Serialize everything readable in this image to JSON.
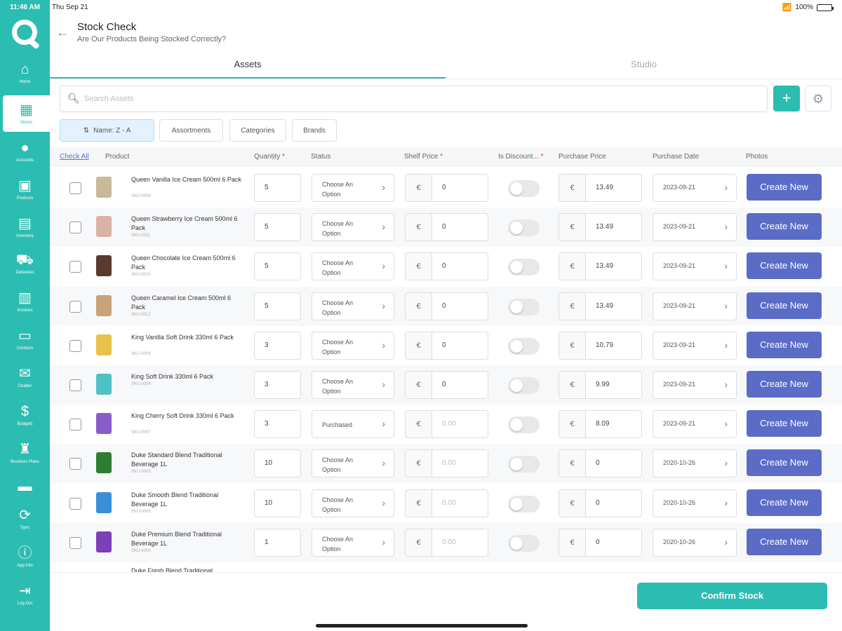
{
  "status_bar": {
    "time": "11:46 AM",
    "date": "Thu Sep 21",
    "battery": "100%"
  },
  "sidebar": {
    "items": [
      {
        "label": "Home",
        "icon": "home-icon"
      },
      {
        "label": "Stores",
        "icon": "store-icon",
        "active": true
      },
      {
        "label": "Accounts",
        "icon": "accounts-icon"
      },
      {
        "label": "Products",
        "icon": "products-icon"
      },
      {
        "label": "Inventory",
        "icon": "inventory-icon"
      },
      {
        "label": "Deliveries",
        "icon": "truck-icon"
      },
      {
        "label": "Invoices",
        "icon": "invoice-icon"
      },
      {
        "label": "Contacts",
        "icon": "contacts-icon"
      },
      {
        "label": "Chatter",
        "icon": "mail-icon"
      },
      {
        "label": "Budgets",
        "icon": "budget-icon"
      },
      {
        "label": "Business Plans",
        "icon": "business-plans-icon"
      },
      {
        "label": "",
        "icon": "card-icon"
      },
      {
        "label": "Sync",
        "icon": "sync-icon"
      },
      {
        "label": "App Info",
        "icon": "info-icon"
      },
      {
        "label": "Log Out",
        "icon": "logout-icon"
      }
    ]
  },
  "header": {
    "title": "Stock Check",
    "subtitle": "Are Our Products Being Stocked Correctly?"
  },
  "tabs": [
    {
      "label": "Assets",
      "active": true
    },
    {
      "label": "Studio"
    }
  ],
  "search": {
    "placeholder": "Search Assets",
    "value": ""
  },
  "filters": {
    "sort": "Name: Z - A",
    "assortments": "Assortments",
    "categories": "Categories",
    "brands": "Brands"
  },
  "columns": {
    "check_all": "Check All",
    "product": "Product",
    "quantity": "Quantity",
    "status": "Status",
    "shelf_price": "Shelf Price",
    "is_discounted": "Is Discount...",
    "purchase_price": "Purchase Price",
    "purchase_date": "Purchase Date",
    "photos": "Photos"
  },
  "currency": "€",
  "create_label": "Create New",
  "rows": [
    {
      "name": "Queen Vanilla Ice Cream 500ml 6 Pack",
      "sku": "SKU-0009",
      "qty": "5",
      "status": "Choose An Option",
      "shelf": "0",
      "purchase": "13.49",
      "date": "2023-09-21",
      "thumb": "#c8b99a"
    },
    {
      "name": "Queen Strawberry Ice Cream 500ml 6 Pack",
      "sku": "SKU-0011",
      "qty": "5",
      "status": "Choose An Option",
      "shelf": "0",
      "purchase": "13.49",
      "date": "2023-09-21",
      "thumb": "#d9b3a6"
    },
    {
      "name": "Queen Chocolate Ice Cream 500ml 6 Pack",
      "sku": "SKU-0010",
      "qty": "5",
      "status": "Choose An Option",
      "shelf": "0",
      "purchase": "13.49",
      "date": "2023-09-21",
      "thumb": "#5a3a2e"
    },
    {
      "name": "Queen Caramel Ice Cream 500ml 6 Pack",
      "sku": "SKU-0012",
      "qty": "5",
      "status": "Choose An Option",
      "shelf": "0",
      "purchase": "13.49",
      "date": "2023-09-21",
      "thumb": "#c9a27a"
    },
    {
      "name": "King Vanilla Soft Drink 330ml 6 Pack",
      "sku": "SKU-0008",
      "qty": "3",
      "status": "Choose An Option",
      "shelf": "0",
      "purchase": "10.79",
      "date": "2023-09-21",
      "thumb": "#e8c24a"
    },
    {
      "name": "King Soft Drink 330ml 6 Pack",
      "sku": "SKU-0006",
      "qty": "3",
      "status": "Choose An Option",
      "shelf": "0",
      "purchase": "9.99",
      "date": "2023-09-21",
      "thumb": "#4fc1c4"
    },
    {
      "name": "King Cherry Soft Drink 330ml 6 Pack",
      "sku": "SKU-0007",
      "qty": "3",
      "status": "Purchased",
      "shelf": "0.00",
      "shelf_placeholder": true,
      "purchase": "8.09",
      "date": "2023-09-21",
      "thumb": "#8a5cc9"
    },
    {
      "name": "Duke Standard Blend Traditional Beverage 1L",
      "sku": "SKU-0003",
      "qty": "10",
      "status": "Choose An Option",
      "shelf": "0.00",
      "shelf_placeholder": true,
      "purchase": "0",
      "date": "2020-10-26",
      "thumb": "#2e7d32"
    },
    {
      "name": "Duke Smooth Blend Traditional Beverage 1L",
      "sku": "SKU-0005",
      "qty": "10",
      "status": "Choose An Option",
      "shelf": "0.00",
      "shelf_placeholder": true,
      "purchase": "0",
      "date": "2020-10-26",
      "thumb": "#3a8fd9"
    },
    {
      "name": "Duke Premium Blend Traditional Beverage 1L",
      "sku": "SKU-0004",
      "qty": "1",
      "status": "Choose An Option",
      "shelf": "0.00",
      "shelf_placeholder": true,
      "purchase": "0",
      "date": "2020-10-26",
      "thumb": "#7b3fb8"
    }
  ],
  "partial_row_name": "Duke Fresh Blend Traditional",
  "footer": {
    "confirm_label": "Confirm Stock"
  }
}
